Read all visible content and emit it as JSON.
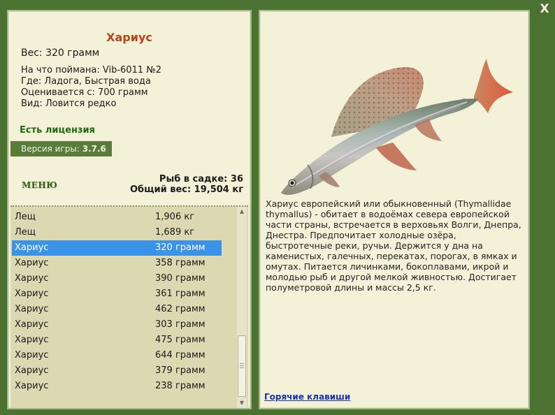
{
  "fish": {
    "title": "Хариус",
    "weight": "Вес: 320 грамм",
    "caught_on": "На что поймана: Vib-6011 №2",
    "location": "Где: Ладога, Быстрая вода",
    "valued_from": "Оценивается с: 700 грамм",
    "kind": "Вид: Ловится редко"
  },
  "license": "Есть лицензия",
  "version": {
    "label": "Версия игры:",
    "value": "3.7.6"
  },
  "menu_label": "МЕНЮ",
  "stats": {
    "fish_in_keepnet": "Рыб в садке: 36",
    "total_weight": "Общий вес: 19,504 кг"
  },
  "catch_list": [
    {
      "name": "Лещ",
      "weight": "1,906 кг"
    },
    {
      "name": "Лещ",
      "weight": "1,689 кг"
    },
    {
      "name": "Хариус",
      "weight": "320 грамм",
      "selected": true
    },
    {
      "name": "Хариус",
      "weight": "358 грамм"
    },
    {
      "name": "Хариус",
      "weight": "390 грамм"
    },
    {
      "name": "Хариус",
      "weight": "361 грамм"
    },
    {
      "name": "Хариус",
      "weight": "462 грамм"
    },
    {
      "name": "Хариус",
      "weight": "303 грамм"
    },
    {
      "name": "Хариус",
      "weight": "475 грамм"
    },
    {
      "name": "Хариус",
      "weight": "644 грамм"
    },
    {
      "name": "Хариус",
      "weight": "379 грамм"
    },
    {
      "name": "Хариус",
      "weight": "238 грамм"
    }
  ],
  "description": "Хариус европейский или обыкновенный (Thymallidae thymallus) - обитает в водоёмах севера европейской части страны, встречается в верховьях Волги, Днепра, Днестра. Предпочитает холодные озёра, быстротечные реки, ручьи. Держится у дна на каменистых, галечных, перекатах, порогах, в ямках и омутах. Питается личинками, бокоплавами, икрой и молодью рыб и другой мелкой живностью. Достигает полуметровой длины и массы 2,5 кг.",
  "hotkeys_link": "Горячие клавиши",
  "close_label": "X",
  "icons": {
    "close": "close-icon",
    "fish_image": "grayling-fish-image"
  },
  "colors": {
    "background": "#4c7231",
    "panel": "#f4f1d9",
    "title": "#b4441a",
    "license": "#1d6a0f",
    "selection": "#3b93e8",
    "link": "#1a33a8"
  }
}
